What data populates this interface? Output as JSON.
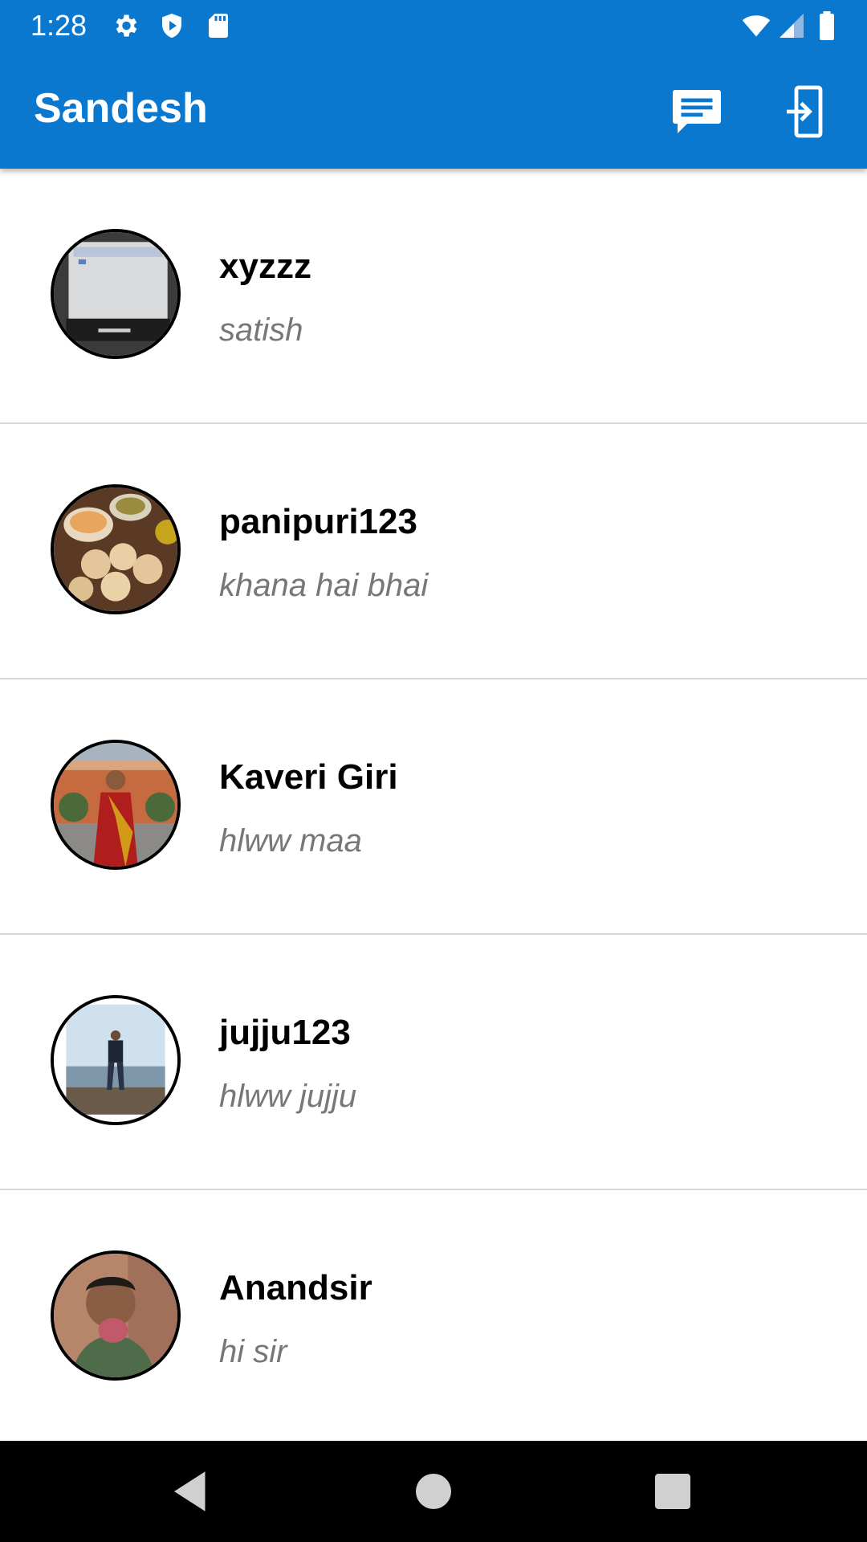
{
  "status_bar": {
    "time": "1:28",
    "icons_left": [
      "settings-icon",
      "shield-icon",
      "sd-card-icon"
    ],
    "icons_right": [
      "wifi-icon",
      "cellular-signal-icon",
      "battery-icon"
    ]
  },
  "app_bar": {
    "title": "Sandesh",
    "actions": [
      "message-icon",
      "logout-icon"
    ],
    "color": "#0b78d0"
  },
  "chats": [
    {
      "name": "xyzzz",
      "last_message": "satish",
      "avatar": "laptop-photo-avatar"
    },
    {
      "name": "panipuri123",
      "last_message": "khana hai bhai",
      "avatar": "food-photo-avatar"
    },
    {
      "name": "Kaveri Giri",
      "last_message": "hlww maa",
      "avatar": "woman-saree-photo-avatar"
    },
    {
      "name": "jujju123",
      "last_message": "hlww jujju",
      "avatar": "man-beach-photo-avatar"
    },
    {
      "name": "Anandsir",
      "last_message": "hi sir",
      "avatar": "man-portrait-photo-avatar"
    }
  ],
  "nav_bar": {
    "buttons": [
      "back-icon",
      "home-icon",
      "recents-icon"
    ]
  }
}
